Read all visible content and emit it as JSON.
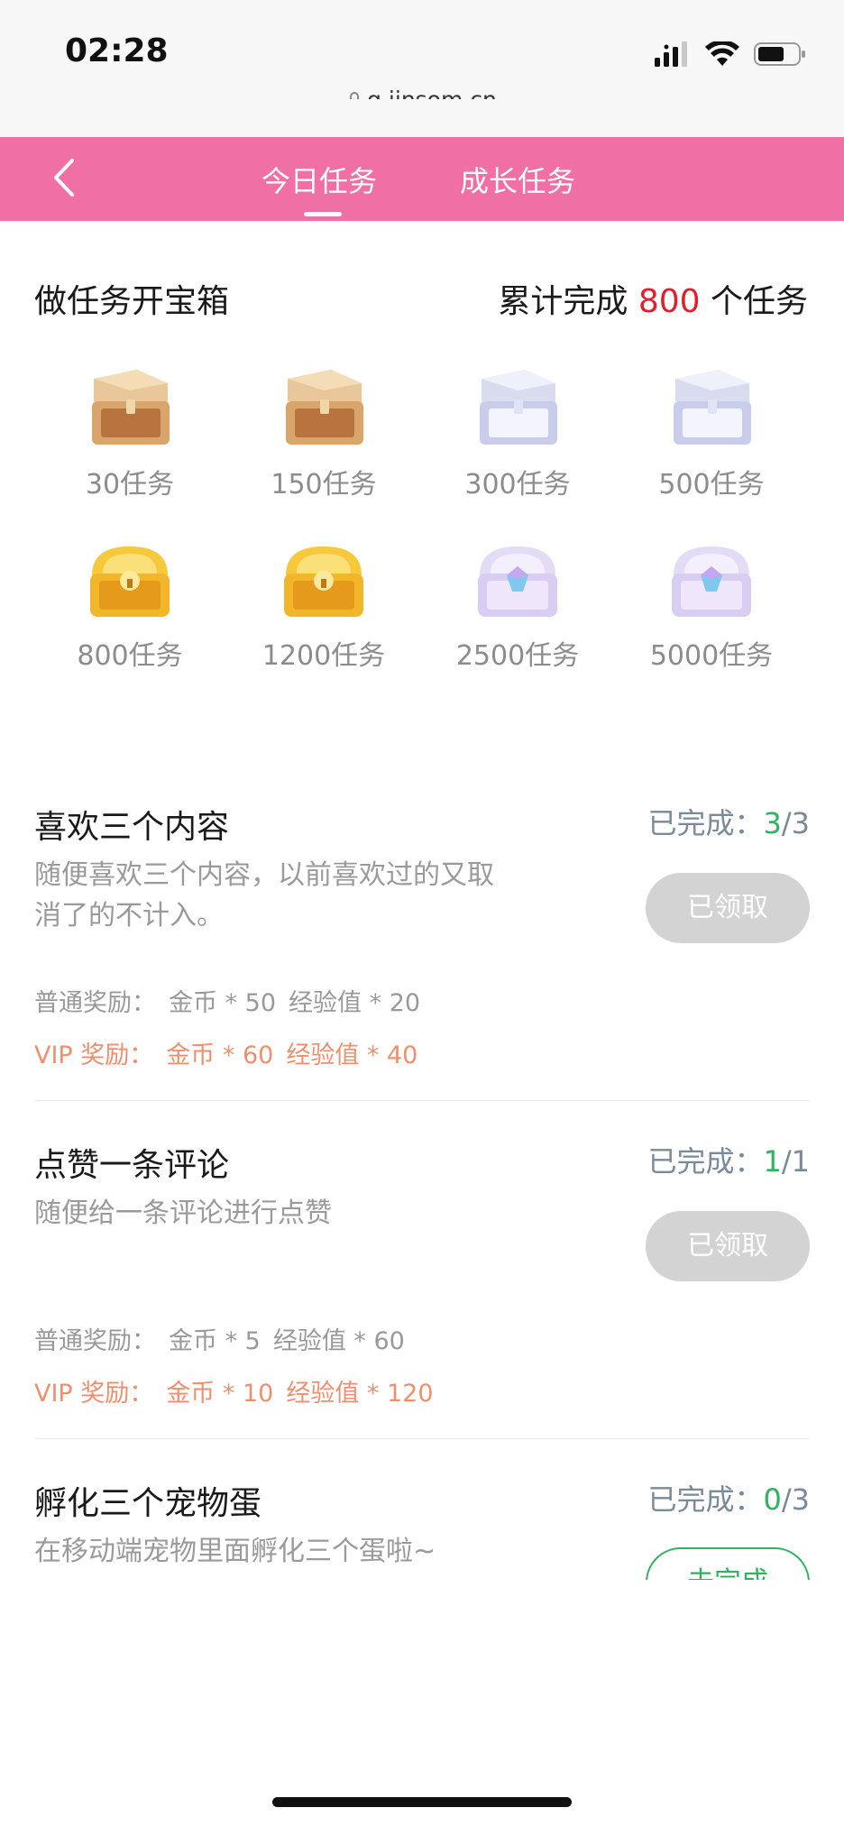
{
  "status_bar": {
    "time": "02:28",
    "url": "q.jinsom.cn"
  },
  "header": {
    "tabs": [
      {
        "label": "今日任务",
        "active": true
      },
      {
        "label": "成长任务",
        "active": false
      }
    ],
    "bg_color": "#f06fa5"
  },
  "treasure": {
    "title": "做任务开宝箱",
    "total_prefix": "累计完成 ",
    "total_count": "800",
    "total_suffix": " 个任务",
    "chests": [
      {
        "label": "30任务",
        "icon": "wooden-chest-open-icon"
      },
      {
        "label": "150任务",
        "icon": "wooden-chest-open-icon"
      },
      {
        "label": "300任务",
        "icon": "silver-chest-open-icon"
      },
      {
        "label": "500任务",
        "icon": "silver-chest-open-icon"
      },
      {
        "label": "800任务",
        "icon": "gold-chest-icon"
      },
      {
        "label": "1200任务",
        "icon": "gold-chest-icon"
      },
      {
        "label": "2500任务",
        "icon": "diamond-chest-icon"
      },
      {
        "label": "5000任务",
        "icon": "diamond-chest-icon"
      }
    ]
  },
  "tasks": [
    {
      "title": "喜欢三个内容",
      "progress_label": "已完成：",
      "progress_done": "3",
      "progress_total": "/3",
      "desc": "随便喜欢三个内容，以前喜欢过的又取消了的不计入。",
      "button": "已领取",
      "normal_label": "普通奖励：",
      "normal_coin": "金币 * 50",
      "normal_exp": "经验值 * 20",
      "vip_label": "VIP 奖励：",
      "vip_coin": "金币 * 60",
      "vip_exp": "经验值 * 40"
    },
    {
      "title": "点赞一条评论",
      "progress_label": "已完成：",
      "progress_done": "1",
      "progress_total": "/1",
      "desc": "随便给一条评论进行点赞",
      "button": "已领取",
      "normal_label": "普通奖励：",
      "normal_coin": "金币 * 5",
      "normal_exp": "经验值 * 60",
      "vip_label": "VIP 奖励：",
      "vip_coin": "金币 * 10",
      "vip_exp": "经验值 * 120"
    },
    {
      "title": "孵化三个宠物蛋",
      "progress_label": "已完成：",
      "progress_done": "0",
      "progress_total": "/3",
      "desc": "在移动端宠物里面孵化三个蛋啦~",
      "button": "未完成"
    }
  ],
  "colors": {
    "accent_pink": "#f06fa5",
    "count_red": "#e0212b",
    "done_green": "#2fb35e",
    "vip_orange": "#ef8f6d"
  }
}
